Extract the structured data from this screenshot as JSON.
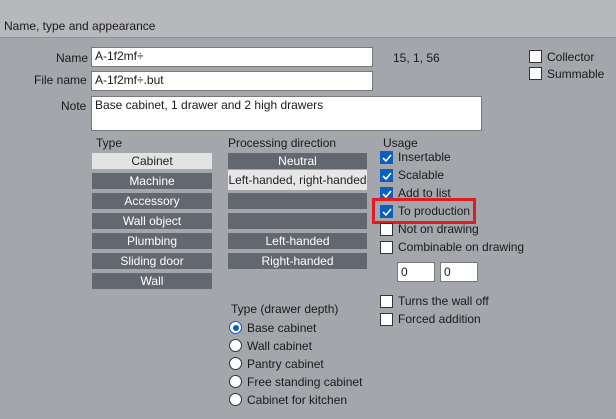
{
  "header": {
    "title": "Name, type and appearance"
  },
  "fields": {
    "name_label": "Name",
    "name_value": "A-1f2mf÷",
    "coords": "15, 1, 56",
    "filename_label": "File name",
    "filename_value": "A-1f2mf÷.but",
    "note_label": "Note",
    "note_value": "Base cabinet, 1 drawer and 2 high drawers"
  },
  "flags": {
    "collector": {
      "label": "Collector",
      "checked": false
    },
    "summable": {
      "label": "Summable",
      "checked": false
    }
  },
  "type": {
    "label": "Type",
    "items": [
      "Cabinet",
      "Machine",
      "Accessory",
      "Wall object",
      "Plumbing",
      "Sliding door",
      "Wall"
    ],
    "selected": "Cabinet"
  },
  "processing": {
    "label": "Processing direction",
    "items": [
      "Neutral",
      "Left-handed, right-handed",
      "",
      "",
      "Left-handed",
      "Right-handed"
    ],
    "selected": "Left-handed, right-handed"
  },
  "usage": {
    "label": "Usage",
    "items": [
      {
        "label": "Insertable",
        "checked": true
      },
      {
        "label": "Scalable",
        "checked": true
      },
      {
        "label": "Add to list",
        "checked": true
      },
      {
        "label": "To production",
        "checked": true
      },
      {
        "label": "Not on drawing",
        "checked": false
      },
      {
        "label": "Combinable on drawing",
        "checked": false
      }
    ],
    "num1": "0",
    "num2": "0",
    "extra": [
      {
        "label": "Turns the wall off",
        "checked": false
      },
      {
        "label": "Forced addition",
        "checked": false
      }
    ]
  },
  "drawer_depth": {
    "label": "Type (drawer depth)",
    "options": [
      "Base cabinet",
      "Wall cabinet",
      "Pantry cabinet",
      "Free standing cabinet",
      "Cabinet for kitchen"
    ],
    "selected": "Base cabinet"
  },
  "colors": {
    "accent": "#0a5fc0",
    "highlight": "#e01b24",
    "button": "#636870"
  }
}
